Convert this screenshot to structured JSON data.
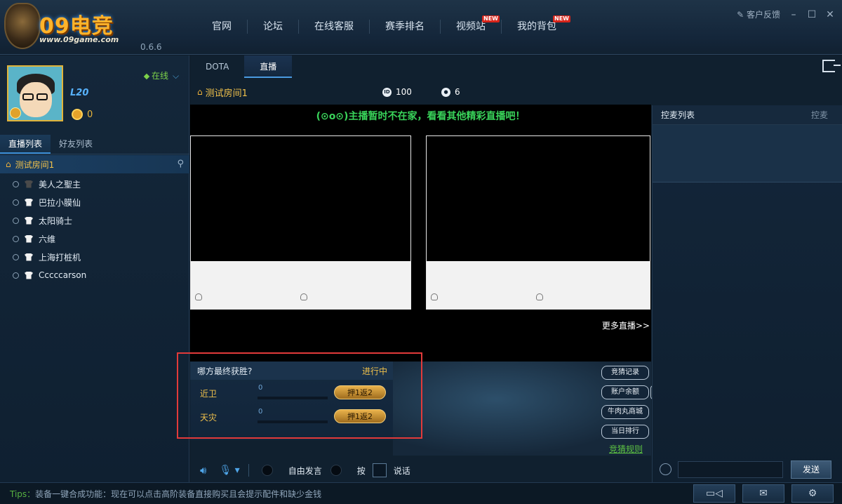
{
  "app": {
    "brand": "09电竞",
    "url": "www.09game.com",
    "version": "0.6.6"
  },
  "nav": [
    {
      "label": "官网",
      "badge": ""
    },
    {
      "label": "论坛",
      "badge": ""
    },
    {
      "label": "在线客服",
      "badge": ""
    },
    {
      "label": "赛季排名",
      "badge": ""
    },
    {
      "label": "视频站",
      "badge": "NEW"
    },
    {
      "label": "我的背包",
      "badge": "NEW"
    }
  ],
  "window": {
    "feedback": "客户反馈"
  },
  "profile": {
    "status": "在线",
    "level": "L20",
    "coins": "0"
  },
  "left_tabs": [
    "直播列表",
    "好友列表"
  ],
  "room": {
    "name": "测试房间1",
    "id": "100",
    "count": "6"
  },
  "users": [
    {
      "name": "美人之聖主",
      "shirt": "dark"
    },
    {
      "name": "巴拉小膜仙",
      "shirt": "light"
    },
    {
      "name": "太阳骑士",
      "shirt": "light"
    },
    {
      "name": "六维",
      "shirt": "light"
    },
    {
      "name": "上海打桩机",
      "shirt": "light"
    },
    {
      "name": "Cccccarson",
      "shirt": "light"
    }
  ],
  "center_tabs": [
    "DOTA",
    "直播"
  ],
  "stage": {
    "notice": "(⊙o⊙)主播暂时不在家，看看其他精彩直播吧！",
    "more": "更多直播>>"
  },
  "guess": {
    "question": "哪方最终获胜?",
    "state": "进行中",
    "teams": [
      {
        "name": "近卫",
        "amount": "0",
        "bet_label": "押1返2"
      },
      {
        "name": "天灾",
        "amount": "0",
        "bet_label": "押1返2"
      }
    ],
    "side_buttons": [
      "竞猜记录",
      "账户余额",
      "牛肉丸商城",
      "当日排行"
    ],
    "plus": "+",
    "rules": "竞猜规则"
  },
  "voice": {
    "free_talk": "自由发言",
    "press": "按",
    "talk": "说话"
  },
  "chat": {
    "title": "控麦列表",
    "action": "控麦",
    "send": "发送"
  },
  "footer": {
    "tips_label": "Tips：",
    "tips_text": "装备一键合成功能：现在可以点击高阶装备直接购买且会提示配件和缺少金钱"
  },
  "colors": {
    "accent_gold": "#f0c14b",
    "online_green": "#7cd14a",
    "notice_green": "#39d35a",
    "highlight_red": "#e23a3a"
  }
}
